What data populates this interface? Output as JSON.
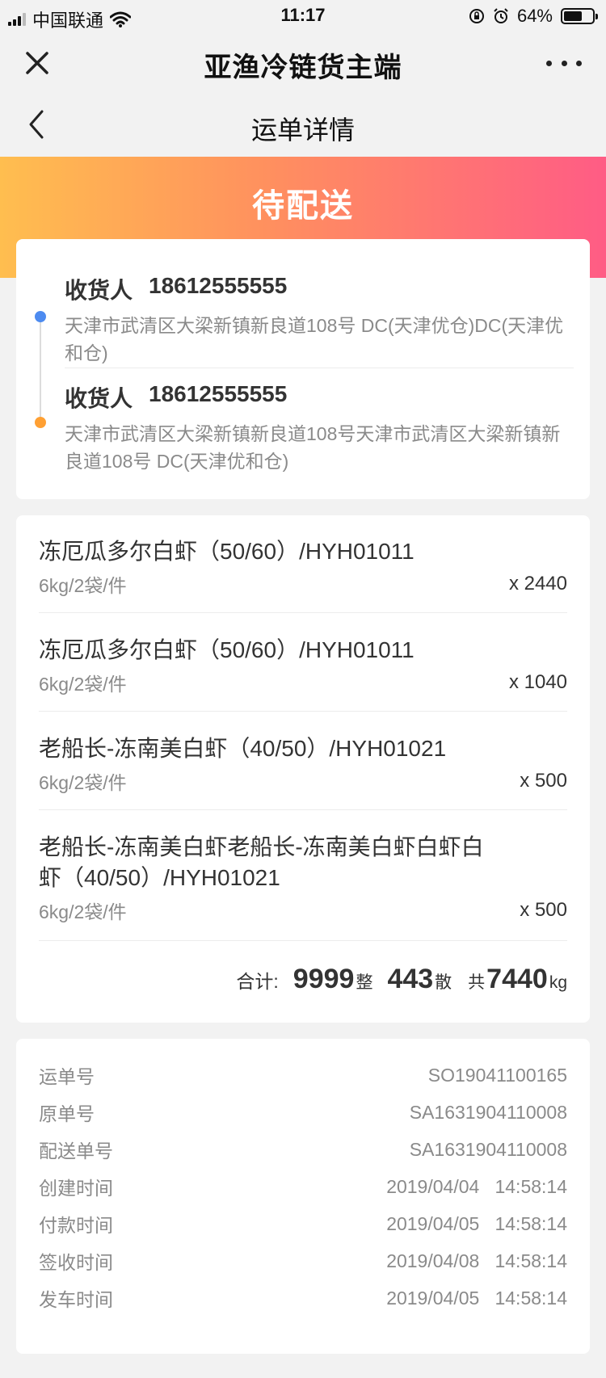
{
  "status_bar": {
    "carrier": "中国联通",
    "time": "11:17",
    "battery": "64%",
    "battery_level": 0.64
  },
  "app_header": {
    "title": "亚渔冷链货主端"
  },
  "nav": {
    "title": "运单详情"
  },
  "banner": {
    "status": "待配送"
  },
  "consignees": [
    {
      "label": "收货人",
      "phone": "18612555555",
      "address": "天津市武清区大梁新镇新良道108号  DC(天津优仓)DC(天津优和仓)"
    },
    {
      "label": "收货人",
      "phone": "18612555555",
      "address": "天津市武清区大梁新镇新良道108号天津市武清区大梁新镇新良道108号 DC(天津优和仓)"
    }
  ],
  "products": [
    {
      "name": "冻厄瓜多尔白虾（50/60）/HYH01011",
      "spec": "6kg/2袋/件",
      "qty": "x 2440"
    },
    {
      "name": "冻厄瓜多尔白虾（50/60）/HYH01011",
      "spec": "6kg/2袋/件",
      "qty": "x 1040"
    },
    {
      "name": "老船长-冻南美白虾（40/50）/HYH01021",
      "spec": "6kg/2袋/件",
      "qty": "x 500"
    },
    {
      "name": "老船长-冻南美白虾老船长-冻南美白虾白虾白虾（40/50）/HYH01021",
      "spec": "6kg/2袋/件",
      "qty": "x 500"
    }
  ],
  "totals": {
    "label": "合计:",
    "whole": "9999",
    "whole_unit": "整",
    "loose": "443",
    "loose_unit": "散",
    "weight_prefix": "共",
    "weight": "7440",
    "weight_unit": "kg"
  },
  "info": [
    {
      "label": "运单号",
      "value": "SO19041100165"
    },
    {
      "label": "原单号",
      "value": "SA1631904110008"
    },
    {
      "label": "配送单号",
      "value": "SA1631904110008"
    },
    {
      "label": "创建时间",
      "value": "2019/04/04   14:58:14"
    },
    {
      "label": "付款时间",
      "value": "2019/04/05   14:58:14"
    },
    {
      "label": "签收时间",
      "value": "2019/04/08   14:58:14"
    },
    {
      "label": "发车时间",
      "value": "2019/04/05   14:58:14"
    }
  ]
}
